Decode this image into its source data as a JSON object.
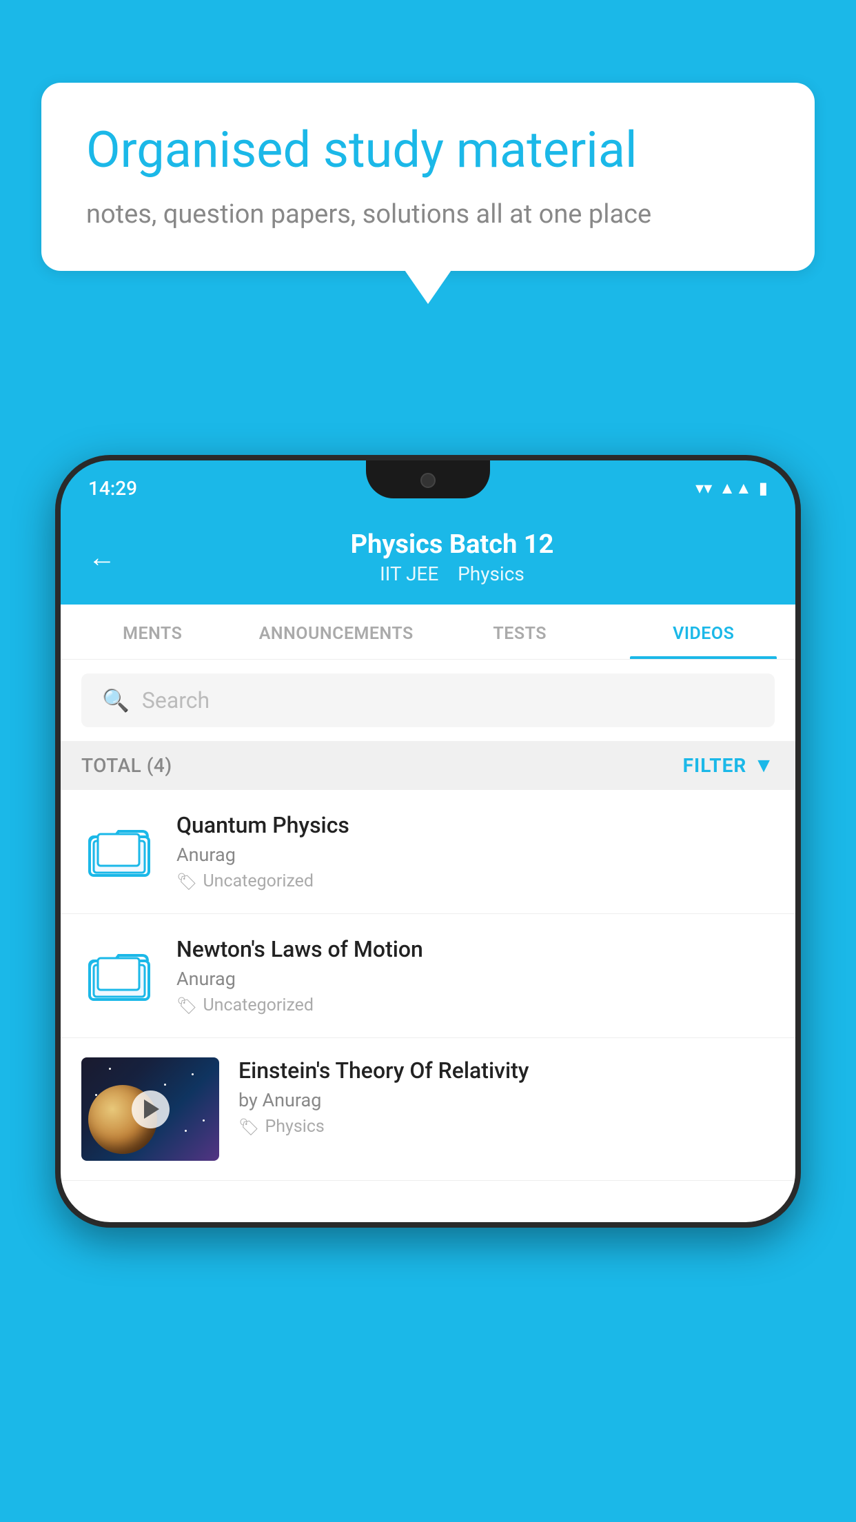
{
  "background_color": "#1BB8E8",
  "hero": {
    "bubble_title": "Organised study material",
    "bubble_subtitle": "notes, question papers, solutions all at one place"
  },
  "phone": {
    "status_time": "14:29",
    "header": {
      "title": "Physics Batch 12",
      "subtitle_part1": "IIT JEE",
      "subtitle_part2": "Physics"
    },
    "tabs": [
      {
        "label": "MENTS",
        "active": false
      },
      {
        "label": "ANNOUNCEMENTS",
        "active": false
      },
      {
        "label": "TESTS",
        "active": false
      },
      {
        "label": "VIDEOS",
        "active": true
      }
    ],
    "search": {
      "placeholder": "Search"
    },
    "filter": {
      "total_label": "TOTAL (4)",
      "filter_label": "FILTER"
    },
    "videos": [
      {
        "id": 1,
        "title": "Quantum Physics",
        "author": "Anurag",
        "tag": "Uncategorized",
        "type": "folder"
      },
      {
        "id": 2,
        "title": "Newton's Laws of Motion",
        "author": "Anurag",
        "tag": "Uncategorized",
        "type": "folder"
      },
      {
        "id": 3,
        "title": "Einstein's Theory Of Relativity",
        "author": "by Anurag",
        "tag": "Physics",
        "type": "video"
      }
    ]
  }
}
